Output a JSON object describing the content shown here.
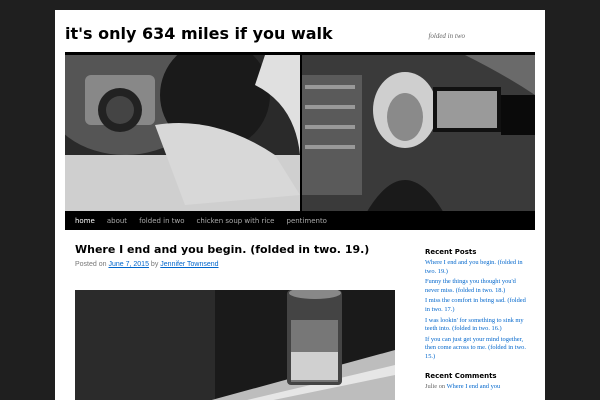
{
  "site": {
    "title": "it's only 634 miles if you walk",
    "description": "folded in two"
  },
  "nav": {
    "items": [
      {
        "label": "home",
        "current": true
      },
      {
        "label": "about",
        "current": false
      },
      {
        "label": "folded in two",
        "current": false
      },
      {
        "label": "chicken soup with rice",
        "current": false
      },
      {
        "label": "pentimento",
        "current": false
      }
    ]
  },
  "post": {
    "title": "Where I end and you begin. (folded in two. 19.)",
    "posted_on": "Posted on",
    "date": "June 7, 2015",
    "by": "by",
    "author": "Jennifer Townsend"
  },
  "sidebar": {
    "recent_posts_title": "Recent Posts",
    "recent_posts": [
      "Where I end and you begin. (folded in two. 19.)",
      "Funny the things you thought you'd never miss. (folded in two. 18.)",
      "I miss the comfort in being sad. (folded in two. 17.)",
      "I was lookin' for something to sink my teeth into. (folded in two. 16.)",
      "If you can just get your mind together, then come across to me. (folded in two. 15.)"
    ],
    "recent_comments_title": "Recent Comments",
    "recent_comment": {
      "author": "Julie",
      "on": "on",
      "link": "Where I end and you"
    }
  }
}
